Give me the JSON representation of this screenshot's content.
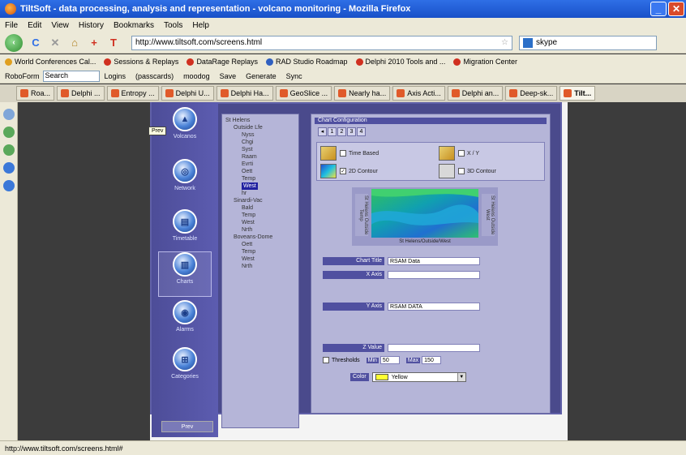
{
  "window": {
    "title": "TiltSoft - data processing, analysis and representation - volcano monitoring - Mozilla Firefox"
  },
  "menu": [
    "File",
    "Edit",
    "View",
    "History",
    "Bookmarks",
    "Tools",
    "Help"
  ],
  "nav": {
    "url": "http://www.tiltsoft.com/screens.html",
    "search_value": "skype"
  },
  "bookmarks": [
    {
      "label": "World Conferences Cal...",
      "color": "#e0a020"
    },
    {
      "label": "Sessions & Replays",
      "color": "#d03020"
    },
    {
      "label": "DataRage Replays",
      "color": "#d03020"
    },
    {
      "label": "RAD Studio Roadmap",
      "color": "#3060c0"
    },
    {
      "label": "Delphi 2010 Tools and ...",
      "color": "#d03020"
    },
    {
      "label": "Migration Center",
      "color": "#d03020"
    }
  ],
  "roboform": {
    "label": "RoboForm",
    "search_label": "Search",
    "items": [
      "Logins",
      "(passcards)",
      "moodog",
      "Save",
      "Generate",
      "Sync"
    ]
  },
  "tabs": [
    "Roa...",
    "Delphi ...",
    "Entropy ...",
    "Delphi U...",
    "Delphi Ha...",
    "GeoSlice ...",
    "Nearly ha...",
    "Axis Acti...",
    "Delphi an...",
    "Deep-sk...",
    "Tilt..."
  ],
  "app": {
    "nav_buttons": [
      "Volcanos",
      "Network",
      "Timetable",
      "Charts",
      "Alarms",
      "Categories"
    ],
    "tooltip": "Prev",
    "bottom_button": "Prev",
    "tree": [
      {
        "label": "St Helens",
        "level": 0
      },
      {
        "label": "Outside Lfe",
        "level": 1
      },
      {
        "label": "Nyss",
        "level": 2
      },
      {
        "label": "Chgi",
        "level": 2
      },
      {
        "label": "Syst",
        "level": 2
      },
      {
        "label": "Raam",
        "level": 2
      },
      {
        "label": "Evrti",
        "level": 2
      },
      {
        "label": "Oett",
        "level": 2
      },
      {
        "label": "Temp",
        "level": 2
      },
      {
        "label": "West",
        "level": 2,
        "selected": true
      },
      {
        "label": "hr",
        "level": 2
      },
      {
        "label": "Sinardi-Vac",
        "level": 1
      },
      {
        "label": "Bald",
        "level": 2
      },
      {
        "label": "Temp",
        "level": 2
      },
      {
        "label": "West",
        "level": 2
      },
      {
        "label": "Nrth",
        "level": 2
      },
      {
        "label": "Boveans-Dome",
        "level": 1
      },
      {
        "label": "Oett",
        "level": 2
      },
      {
        "label": "Temp",
        "level": 2
      },
      {
        "label": "West",
        "level": 2
      },
      {
        "label": "Nrth",
        "level": 2
      }
    ],
    "config": {
      "header": "Chart Configuration",
      "pages": [
        "1",
        "2",
        "3",
        "4"
      ],
      "types": [
        {
          "label": "Time Based",
          "checked": false
        },
        {
          "label": "X / Y",
          "checked": false
        },
        {
          "label": "2D Contour",
          "checked": true
        },
        {
          "label": "3D Contour",
          "checked": false
        }
      ],
      "preview_left": "St Helens Outside Temp",
      "preview_right": "St Helens Outside West",
      "preview_caption": "St Helens/Outside/West",
      "chart_title_label": "Chart Title",
      "chart_title_value": "RSAM Data",
      "x_axis_label": "X Axis",
      "x_axis_value": "",
      "y_axis_label": "Y Axis",
      "y_axis_value": "RSAM DATA",
      "z_value_label": "Z Value",
      "z_value_value": "",
      "thresholds_label": "Thresholds",
      "min_label": "Min",
      "min_value": "50",
      "max_label": "Max",
      "max_value": "150",
      "color_label": "Color",
      "color_value": "Yellow"
    }
  },
  "status": {
    "text": "http://www.tiltsoft.com/screens.html#"
  }
}
